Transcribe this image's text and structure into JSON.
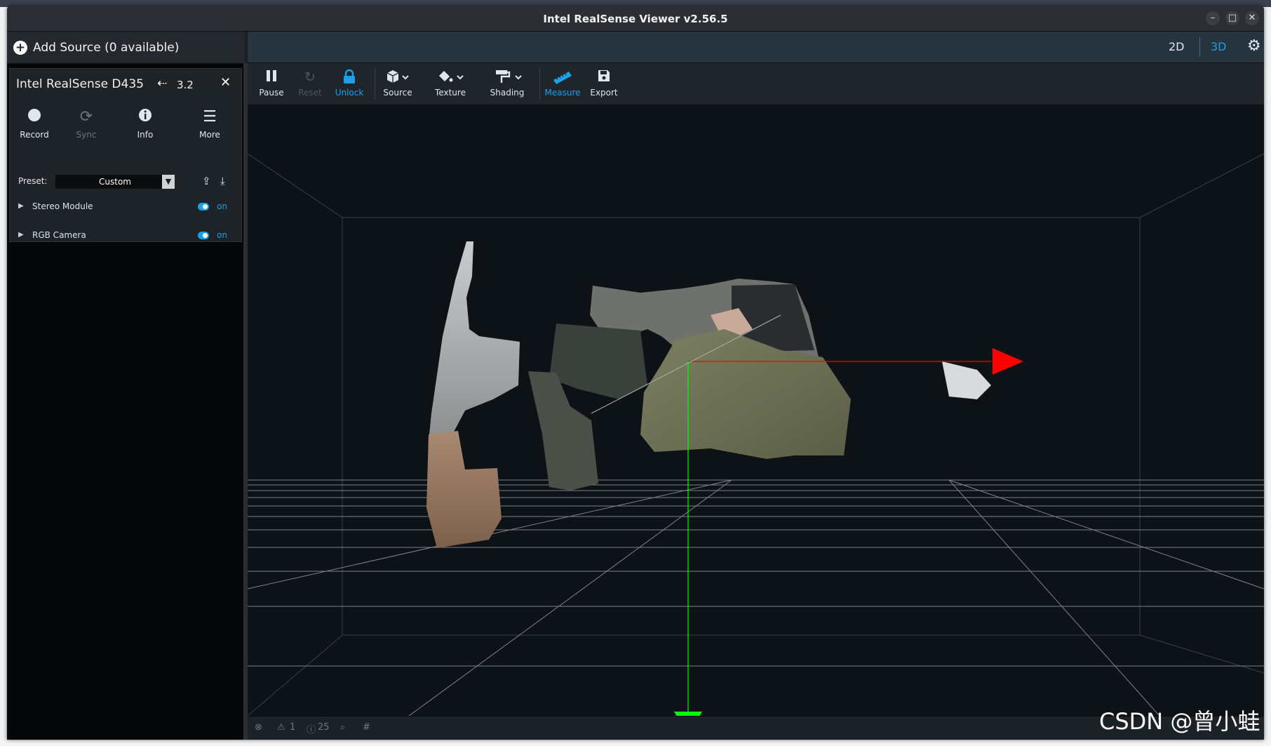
{
  "window": {
    "title": "Intel RealSense Viewer v2.56.5",
    "minimize_glyph": "–",
    "maximize_glyph": "□",
    "close_glyph": "✕"
  },
  "sidebar": {
    "add_source_label": "Add Source (0 available)",
    "device": {
      "name": "Intel RealSense D435",
      "usb_version": "3.2",
      "buttons": [
        {
          "label": "Record",
          "icon": "record-icon",
          "enabled": true
        },
        {
          "label": "Sync",
          "icon": "sync-icon",
          "enabled": false
        },
        {
          "label": "Info",
          "icon": "info-icon",
          "enabled": true
        },
        {
          "label": "More",
          "icon": "menu-icon",
          "enabled": true
        }
      ],
      "preset_label": "Preset:",
      "preset_value": "Custom",
      "modules": [
        {
          "label": "Stereo Module",
          "state": "on"
        },
        {
          "label": "RGB Camera",
          "state": "on"
        }
      ]
    }
  },
  "header": {
    "view_2d": "2D",
    "view_3d": "3D",
    "active_view": "3D"
  },
  "toolbar": {
    "items": [
      {
        "label": "Pause",
        "icon": "pause-icon",
        "state": "normal"
      },
      {
        "label": "Reset",
        "icon": "reset-icon",
        "state": "disabled"
      },
      {
        "label": "Unlock",
        "icon": "lock-icon",
        "state": "active"
      },
      {
        "label": "Source",
        "icon": "cube-icon",
        "state": "normal"
      },
      {
        "label": "Texture",
        "icon": "paint-bucket-icon",
        "state": "normal"
      },
      {
        "label": "Shading",
        "icon": "paint-roller-icon",
        "state": "normal"
      },
      {
        "label": "Measure",
        "icon": "ruler-icon",
        "state": "active"
      },
      {
        "label": "Export",
        "icon": "save-icon",
        "state": "normal"
      }
    ]
  },
  "statusbar": {
    "warnings": "1",
    "infos": "25"
  },
  "watermark": "CSDN @曾小蛙",
  "colors": {
    "accent": "#1aa0e8",
    "x_axis": "#ff0000",
    "y_axis": "#00ff00",
    "grid": "#8a9096"
  }
}
